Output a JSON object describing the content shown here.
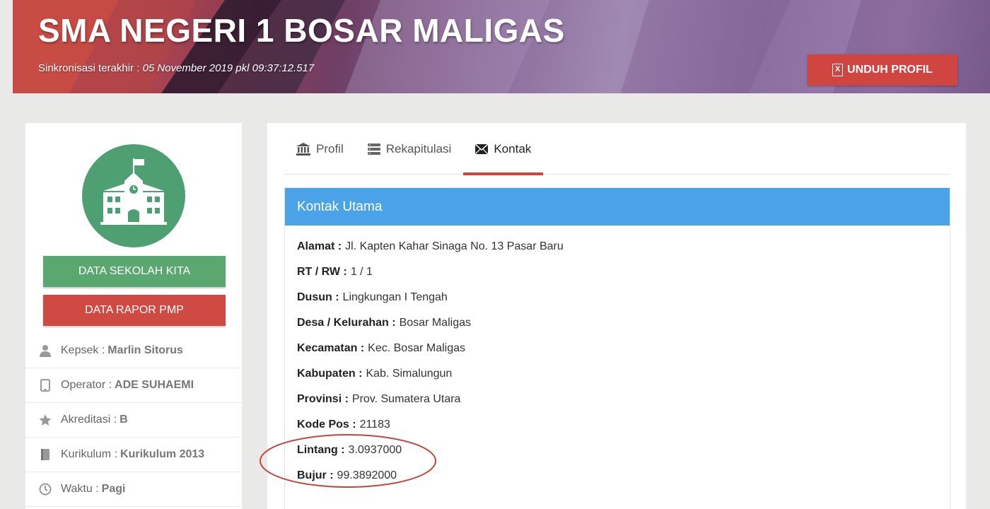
{
  "banner": {
    "title": "SMA NEGERI 1 BOSAR MALIGAS",
    "sync_label": "Sinkronisasi terakhir :",
    "sync_time": "05 November 2019 pkl 09:37:12.517",
    "download_button": "UNDUH PROFIL",
    "download_icon": "excel-file-icon"
  },
  "sidebar": {
    "logo_icon": "school-building-icon",
    "btn_data_sekolah": "DATA SEKOLAH KITA",
    "btn_rapor": "DATA RAPOR PMP",
    "items": [
      {
        "icon": "user-icon",
        "label": "Kepsek :",
        "value": "Marlin Sitorus"
      },
      {
        "icon": "phone-icon",
        "label": "Operator :",
        "value": "ADE SUHAEMI"
      },
      {
        "icon": "star-icon",
        "label": "Akreditasi :",
        "value": "B"
      },
      {
        "icon": "book-icon",
        "label": "Kurikulum :",
        "value": "Kurikulum 2013"
      },
      {
        "icon": "clock-icon",
        "label": "Waktu :",
        "value": "Pagi"
      }
    ]
  },
  "tabs": [
    {
      "icon": "bank-icon",
      "label": "Profil"
    },
    {
      "icon": "list-icon",
      "label": "Rekapitulasi"
    },
    {
      "icon": "envelope-icon",
      "label": "Kontak",
      "active": true
    }
  ],
  "contact": {
    "header": "Kontak Utama",
    "rows": [
      {
        "label": "Alamat :",
        "value": "Jl. Kapten Kahar Sinaga No. 13 Pasar Baru"
      },
      {
        "label": "RT / RW :",
        "value": "1 / 1"
      },
      {
        "label": "Dusun :",
        "value": "Lingkungan I Tengah"
      },
      {
        "label": "Desa / Kelurahan :",
        "value": "Bosar Maligas"
      },
      {
        "label": "Kecamatan :",
        "value": "Kec. Bosar Maligas"
      },
      {
        "label": "Kabupaten :",
        "value": "Kab. Simalungun"
      },
      {
        "label": "Provinsi :",
        "value": "Prov. Sumatera Utara"
      },
      {
        "label": "Kode Pos :",
        "value": "21183"
      },
      {
        "label": "Lintang :",
        "value": "3.0937000"
      },
      {
        "label": "Bujur :",
        "value": "99.3892000"
      }
    ]
  },
  "colors": {
    "accent_red": "#d0453f",
    "accent_green": "#5aa870",
    "header_blue": "#4aa3e6",
    "annotation_circle": "#c0463f"
  }
}
